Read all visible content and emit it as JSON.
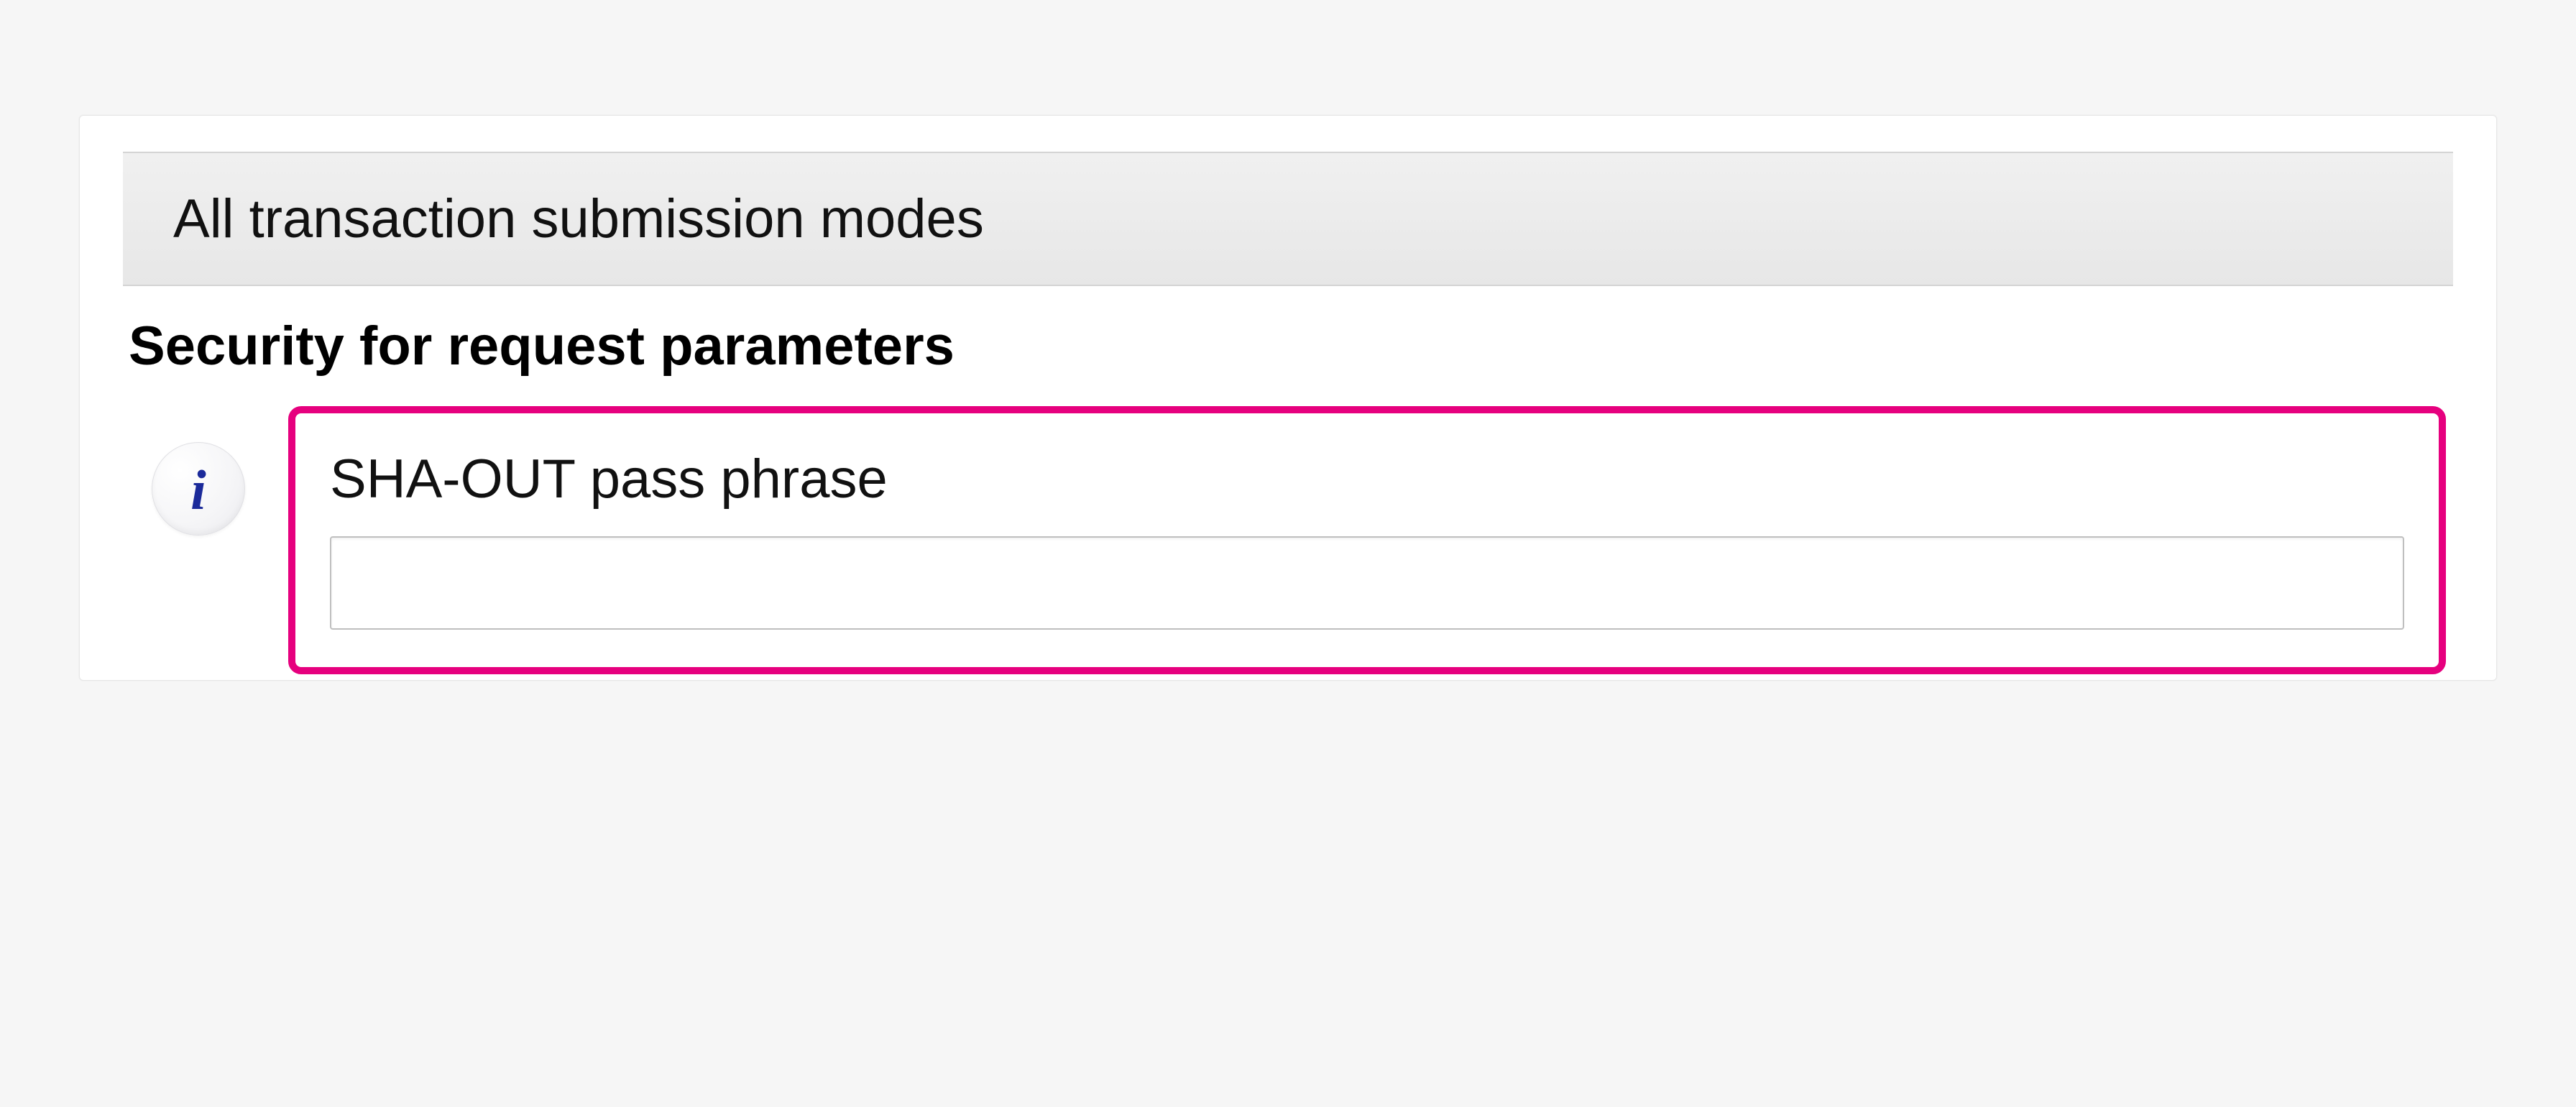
{
  "panel": {
    "section_header": "All transaction submission modes",
    "subsection_title": "Security for request parameters",
    "info_icon_glyph": "i",
    "field": {
      "label": "SHA-OUT pass phrase",
      "value": ""
    }
  },
  "colors": {
    "highlight": "#e6007e",
    "info_icon_text": "#1b2a9a"
  }
}
